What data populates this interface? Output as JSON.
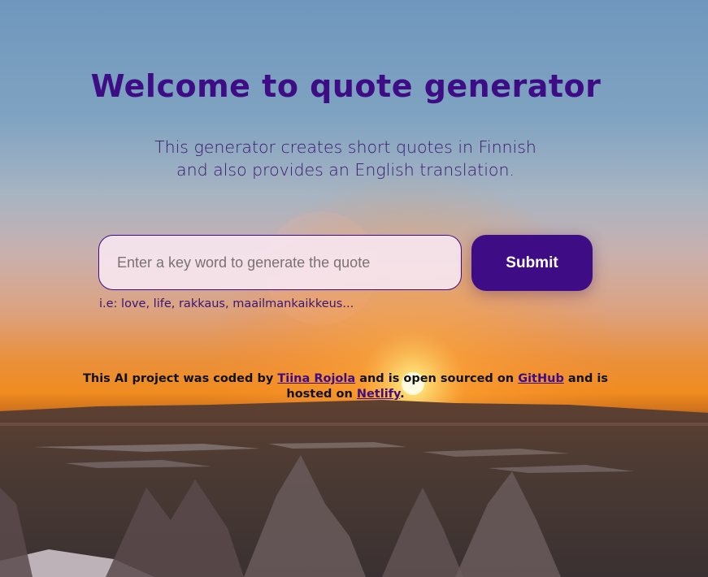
{
  "header": {
    "title": "Welcome to quote generator",
    "subtitle_line1": "This generator creates short quotes in Finnish",
    "subtitle_line2": "and also provides an English translation."
  },
  "form": {
    "input_placeholder": "Enter a key word to generate the quote",
    "input_value": "",
    "submit_label": "Submit",
    "hint": "i.e: love, life, rakkaus, maailmankaikkeus..."
  },
  "footer": {
    "text_1": "This AI project was coded by ",
    "author_link": "Tiina Rojola",
    "text_2": " and is open sourced on ",
    "github_link": "GitHub",
    "text_3": " and is hosted on ",
    "netlify_link": "Netlify",
    "text_4": "."
  },
  "colors": {
    "accent": "#3e0d86",
    "input_background": "#f5e4ec",
    "button_text": "#ffffff"
  }
}
